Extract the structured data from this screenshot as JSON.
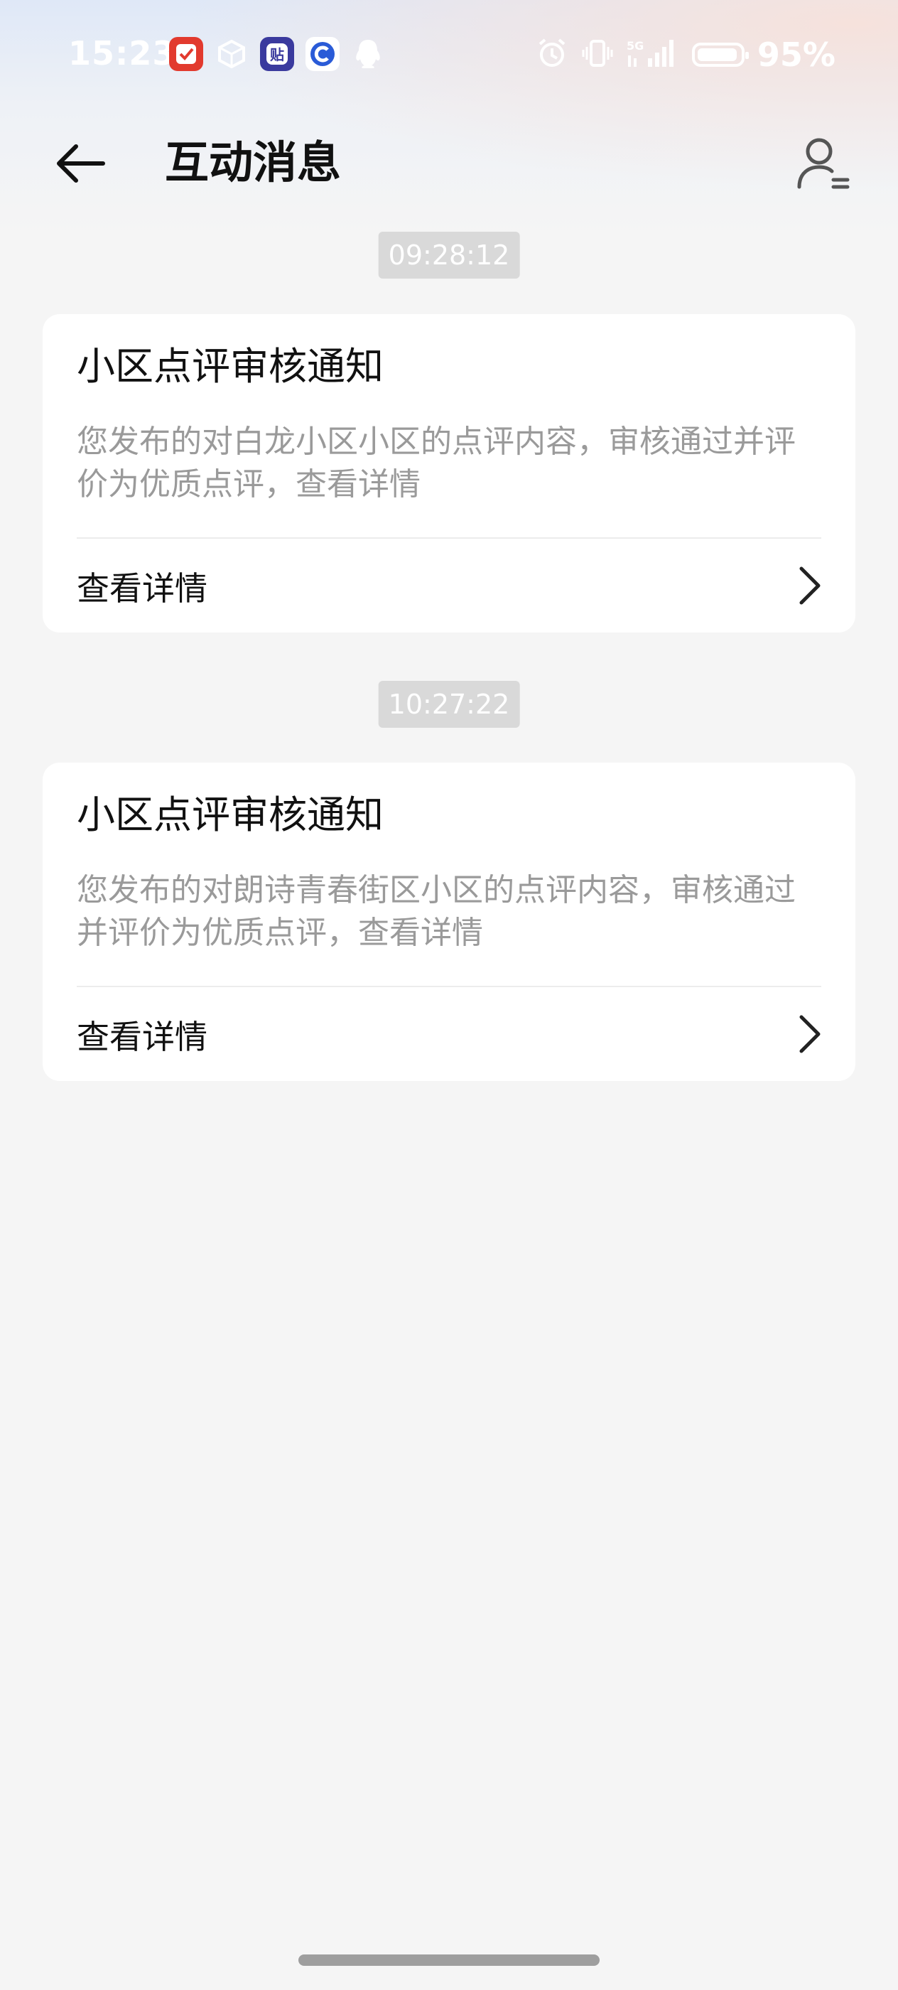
{
  "status_bar": {
    "time": "15:23",
    "battery_percent": 95,
    "battery_text": "95%",
    "app_icons": [
      {
        "icon": "app-shopping-icon",
        "color": "#e23a2e",
        "glyph": "✓"
      },
      {
        "icon": "app-box-icon",
        "color": "#ffffff",
        "glyph": "⬡"
      },
      {
        "icon": "app-tieba-icon",
        "color": "#3a3a9e",
        "glyph": "贴"
      },
      {
        "icon": "app-blue-circle-icon",
        "color": "#2a5bd7",
        "glyph": "◉"
      },
      {
        "icon": "qq-icon",
        "color": "#ffffff",
        "glyph": "♜"
      }
    ],
    "network_label": "5G"
  },
  "header": {
    "title": "互动消息"
  },
  "messages": [
    {
      "time": "09:28:12",
      "title": "小区点评审核通知",
      "description": "您发布的对白龙小区小区的点评内容，审核通过并评价为优质点评，查看详情",
      "action_label": "查看详情"
    },
    {
      "time": "10:27:22",
      "title": "小区点评审核通知",
      "description": "您发布的对朗诗青春街区小区的点评内容，审核通过并评价为优质点评，查看详情",
      "action_label": "查看详情"
    }
  ],
  "colors": {
    "background": "#f5f5f5",
    "card": "#ffffff",
    "timestamp_bg": "#d9d9d9",
    "desc_text": "#9a9a9a"
  }
}
